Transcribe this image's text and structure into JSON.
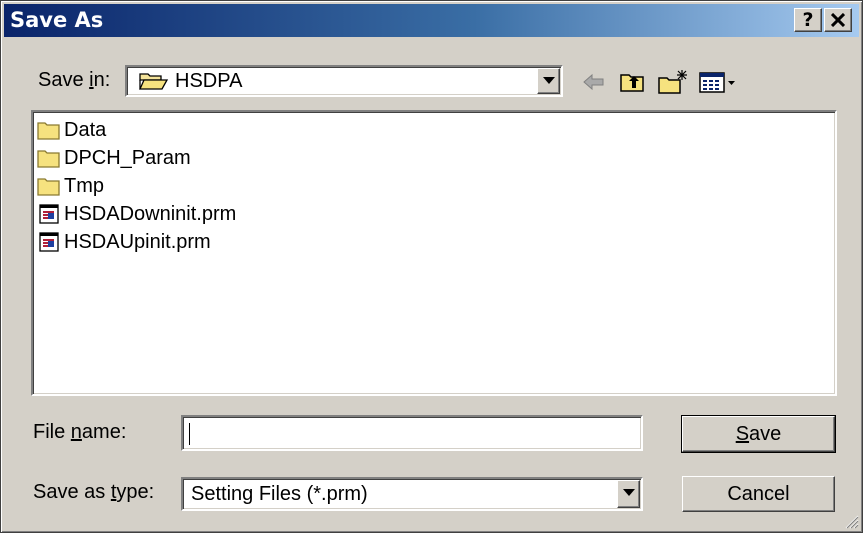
{
  "window": {
    "title": "Save As",
    "help_label": "?",
    "close_label": "✕"
  },
  "save_in": {
    "label_pre": "Save ",
    "label_accel": "i",
    "label_post": "n:",
    "folder_icon": "open-folder-icon",
    "value": "HSDPA"
  },
  "toolbar": {
    "back_icon": "back-arrow-icon",
    "up_icon": "up-one-level-icon",
    "new_folder_icon": "new-folder-icon",
    "view_menu_icon": "view-menu-icon"
  },
  "files": [
    {
      "name": "Data",
      "icon": "folder-icon"
    },
    {
      "name": "DPCH_Param",
      "icon": "folder-icon"
    },
    {
      "name": "Tmp",
      "icon": "folder-icon"
    },
    {
      "name": "HSDADowninit.prm",
      "icon": "prm-file-icon"
    },
    {
      "name": "HSDAUpinit.prm",
      "icon": "prm-file-icon"
    }
  ],
  "file_name": {
    "label_pre": "File ",
    "label_accel": "n",
    "label_post": "ame:",
    "value": ""
  },
  "save_as_type": {
    "label_pre": "Save as ",
    "label_accel": "t",
    "label_post": "ype:",
    "value": "Setting Files (*.prm)"
  },
  "buttons": {
    "save_accel": "S",
    "save_rest": "ave",
    "cancel": "Cancel"
  }
}
